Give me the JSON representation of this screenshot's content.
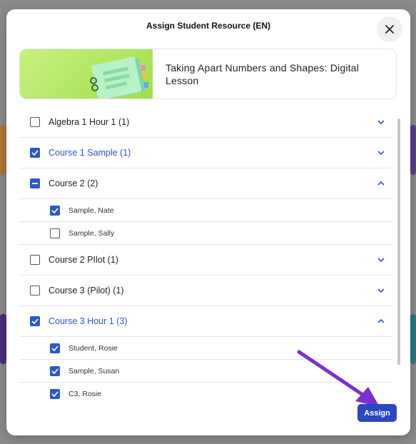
{
  "modal": {
    "title": "Assign Student Resource (EN)",
    "close_icon": "close-icon"
  },
  "resource": {
    "title": "Taking Apart Numbers and Shapes: Digital Lesson",
    "thumb_icon": "notebook-icon"
  },
  "classes": [
    {
      "label": "Algebra 1 Hour 1 (1)",
      "checked": "none",
      "expanded": false
    },
    {
      "label": "Course 1 Sample (1)",
      "checked": "all",
      "expanded": false
    },
    {
      "label": "Course 2 (2)",
      "checked": "partial",
      "expanded": true,
      "students": [
        {
          "label": "Sample, Nate",
          "checked": true
        },
        {
          "label": "Sample, Sally",
          "checked": false
        }
      ]
    },
    {
      "label": "Course 2 PIlot (1)",
      "checked": "none",
      "expanded": false
    },
    {
      "label": "Course 3 (Pilot) (1)",
      "checked": "none",
      "expanded": false
    },
    {
      "label": "Course 3 Hour 1 (3)",
      "checked": "all",
      "expanded": true,
      "students": [
        {
          "label": "Student, Rosie",
          "checked": true
        },
        {
          "label": "Sample, Susan",
          "checked": true
        },
        {
          "label": "C3, Rosie",
          "checked": true
        }
      ]
    }
  ],
  "actions": {
    "assign_label": "Assign"
  },
  "colors": {
    "accent": "#2b57c9",
    "button": "#2b47c2",
    "annotation_arrow": "#7b2fd0"
  }
}
